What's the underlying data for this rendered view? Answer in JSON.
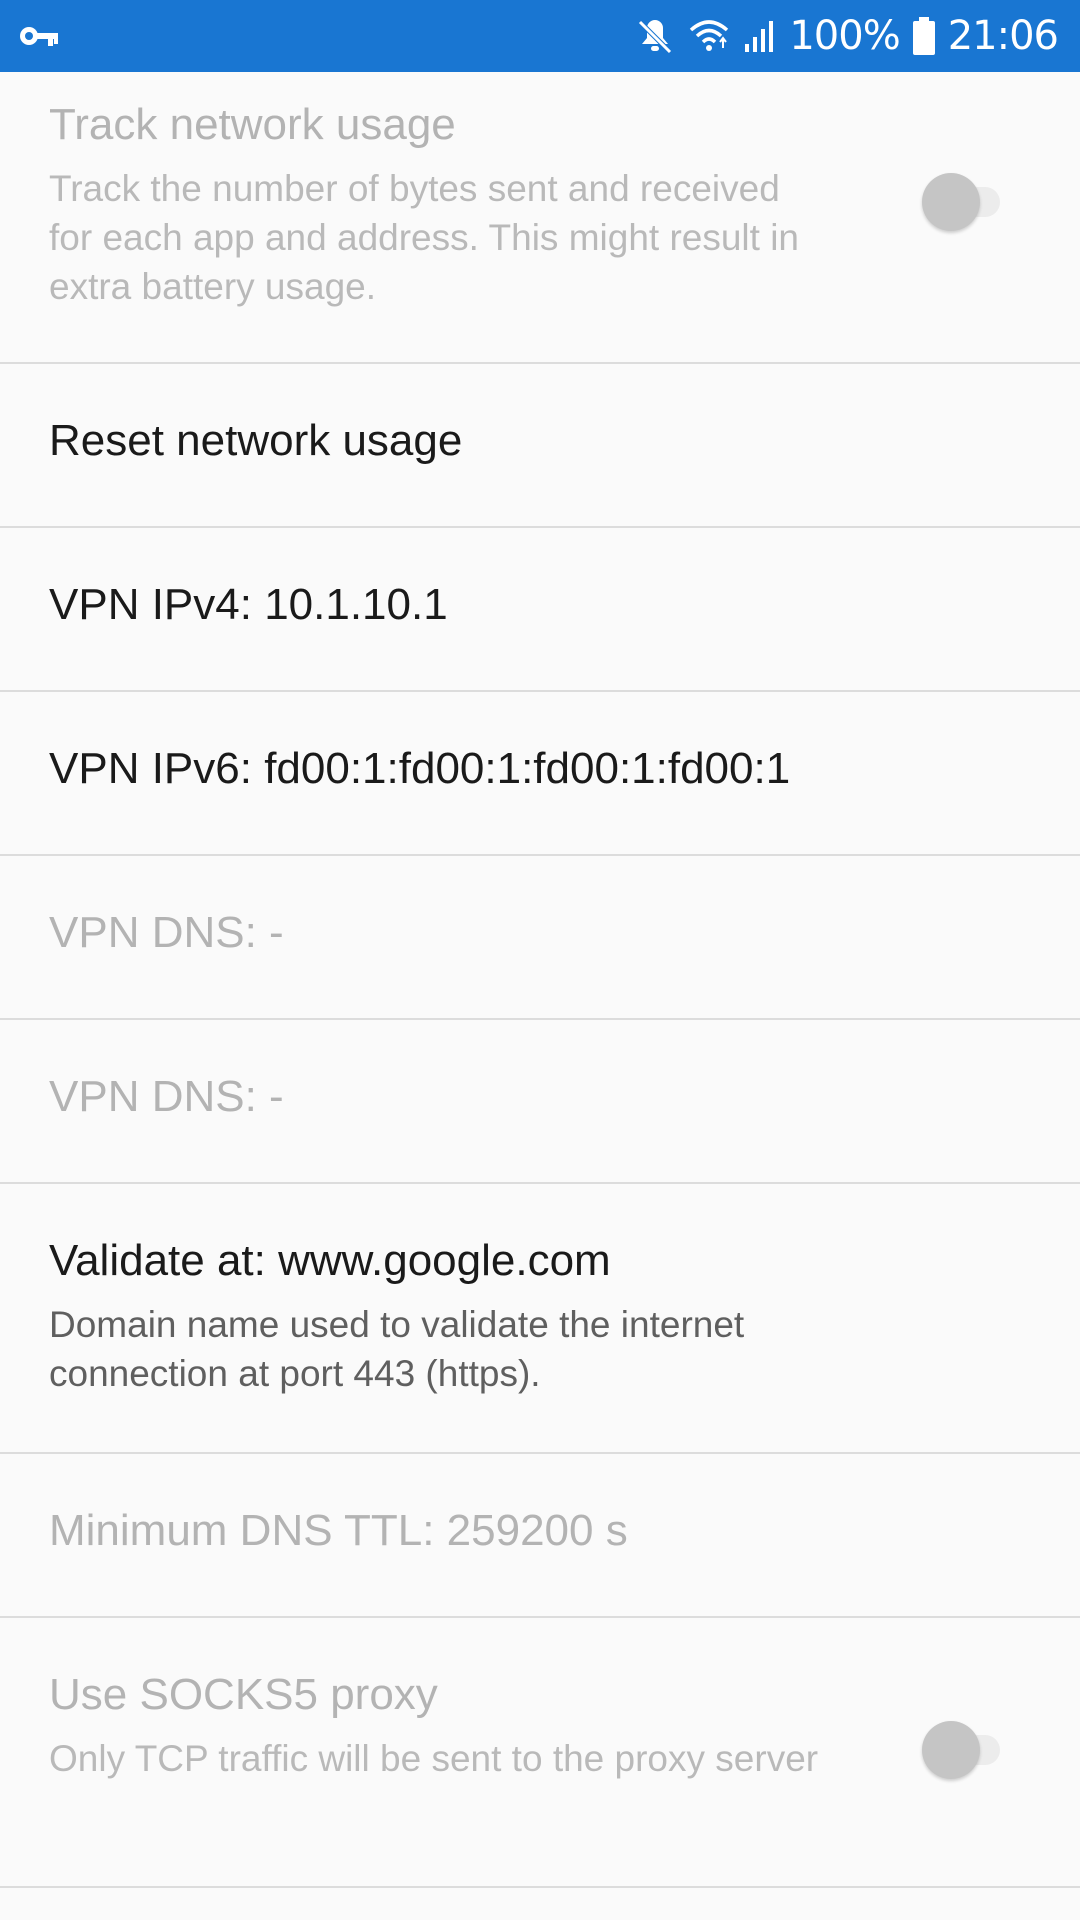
{
  "status_bar": {
    "left_icon": "key-icon",
    "icons": [
      "mute-icon",
      "wifi-icon",
      "signal-icon",
      "battery-icon"
    ],
    "battery_percent": "100%",
    "time": "21:06",
    "background_color": "#1976d2"
  },
  "prefs": {
    "track_usage": {
      "title": "Track network usage",
      "summary": "Track the number of bytes sent and received for each app and address. This might result in extra battery usage.",
      "enabled": false,
      "checked": false
    },
    "reset_usage": {
      "title": "Reset network usage"
    },
    "vpn_ipv4": {
      "title": "VPN IPv4: 10.1.10.1"
    },
    "vpn_ipv6": {
      "title": "VPN IPv6: fd00:1:fd00:1:fd00:1:fd00:1"
    },
    "vpn_dns_1": {
      "title": "VPN DNS: -"
    },
    "vpn_dns_2": {
      "title": "VPN DNS: -"
    },
    "validate": {
      "title": "Validate at: www.google.com",
      "summary": "Domain name used to validate the internet connection at port 443 (https)."
    },
    "min_dns_ttl": {
      "title": "Minimum DNS TTL: 259200 s"
    },
    "socks5": {
      "title": "Use SOCKS5 proxy",
      "summary": "Only TCP traffic will be sent to the proxy server",
      "enabled": false,
      "checked": false
    }
  }
}
